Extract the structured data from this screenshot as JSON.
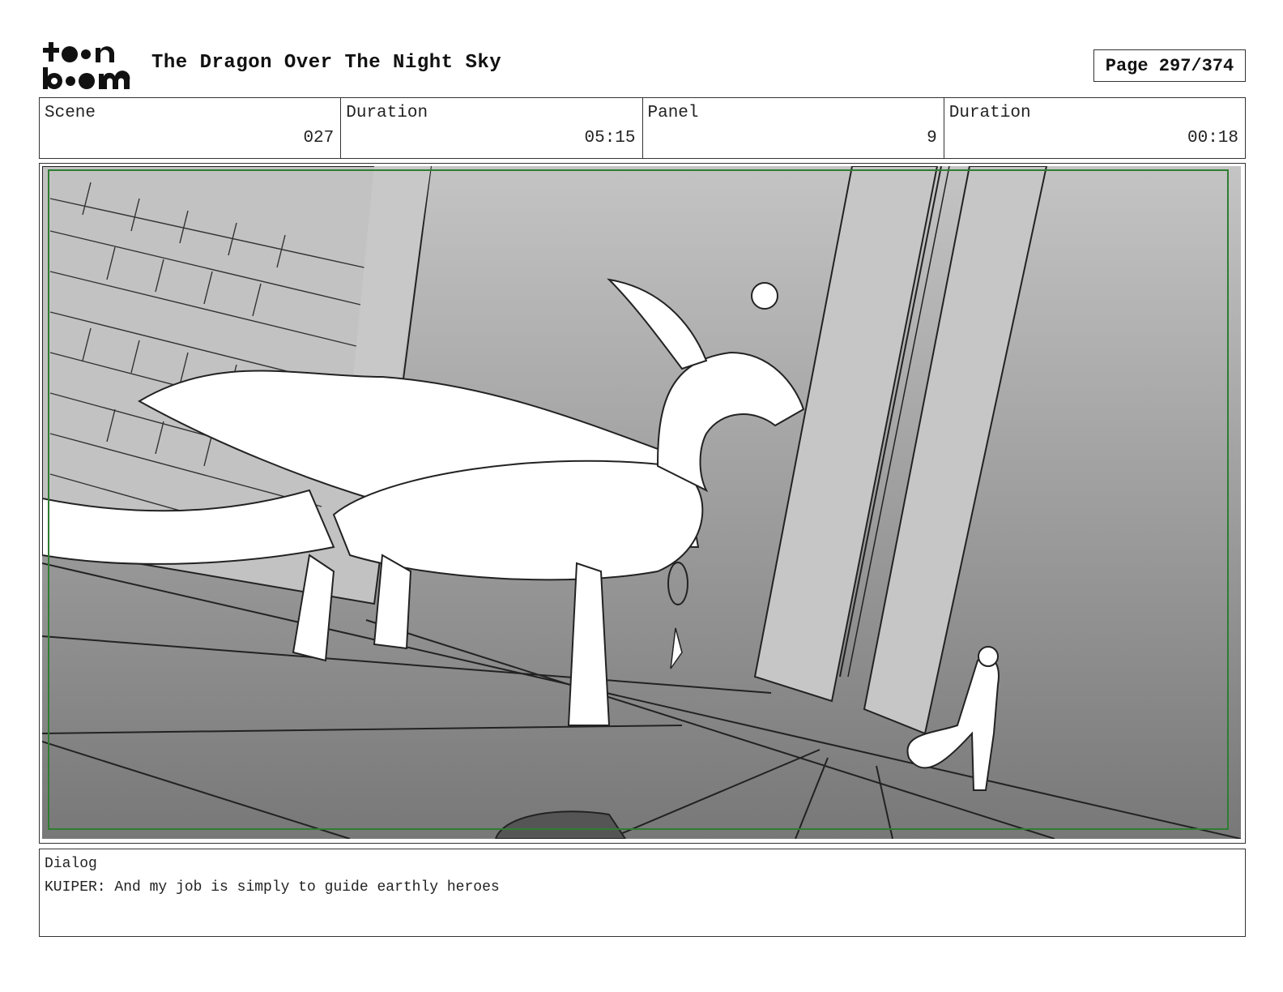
{
  "header": {
    "logo_top": "t●●n",
    "logo_bottom": "b●●m",
    "title": "The Dragon Over The Night Sky",
    "page_indicator": "Page 297/374"
  },
  "info": {
    "scene_label": "Scene",
    "scene_value": "027",
    "scene_duration_label": "Duration",
    "scene_duration_value": "05:15",
    "panel_label": "Panel",
    "panel_value": "9",
    "panel_duration_label": "Duration",
    "panel_duration_value": "00:18"
  },
  "panel": {
    "safe_frame_color": "#2e7d32"
  },
  "dialog": {
    "label": "Dialog",
    "text": "KUIPER: And my job is simply to guide earthly heroes"
  }
}
